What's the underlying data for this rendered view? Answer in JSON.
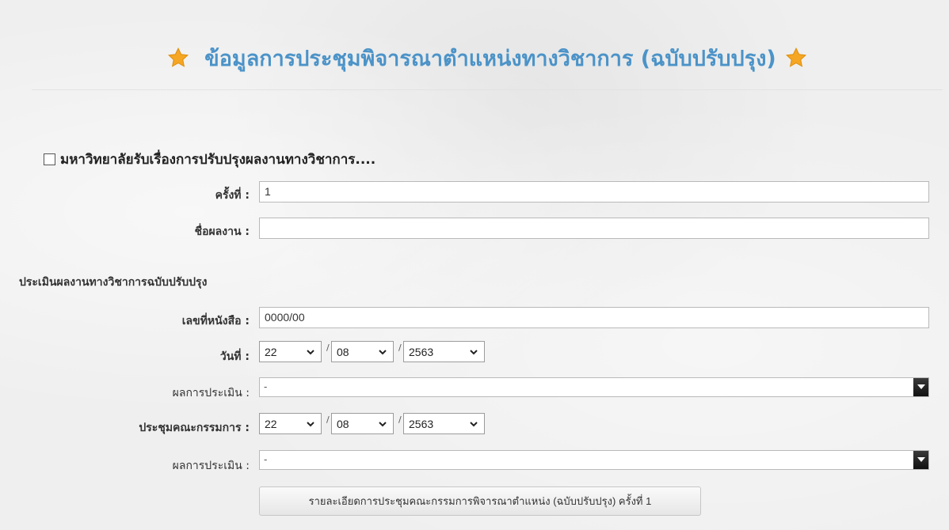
{
  "header": {
    "title": "ข้อมูลการประชุมพิจารณาตำแหน่งทางวิชาการ (ฉบับปรับปรุง)"
  },
  "section": {
    "checkbox_label": "มหาวิทยาลัยรับเรื่องการปรับปรุงผลงานทางวิชาการ...."
  },
  "fields": {
    "round_label": "ครั้งที่ :",
    "round_value": "1",
    "work_name_label": "ชื่อผลงาน :",
    "work_name_value": ""
  },
  "evaluation": {
    "subheading": "ประเมินผลงานทางวิชาการฉบับปรับปรุง",
    "doc_no_label": "เลขที่หนังสือ :",
    "doc_no_value": "0000/00",
    "date_label": "วันที่ :",
    "date": {
      "day": "22",
      "month": "08",
      "year": "2563"
    },
    "result_label": "ผลการประเมิน :",
    "result_value": "-",
    "committee_label": "ประชุมคณะกรรมการ :",
    "committee_date": {
      "day": "22",
      "month": "08",
      "year": "2563"
    },
    "result2_label": "ผลการประเมิน :",
    "result2_value": "-",
    "separator": "/"
  },
  "actions": {
    "detail_button": "รายละเอียดการประชุมคณะกรรมการพิจารณาตำแหน่ง (ฉบับปรับปรุง) ครั้งที่ 1"
  },
  "colors": {
    "title": "#4b93c8",
    "star": "#f5a623"
  },
  "icons": {
    "star": "star-icon",
    "dropdown": "chevron-down-icon"
  }
}
